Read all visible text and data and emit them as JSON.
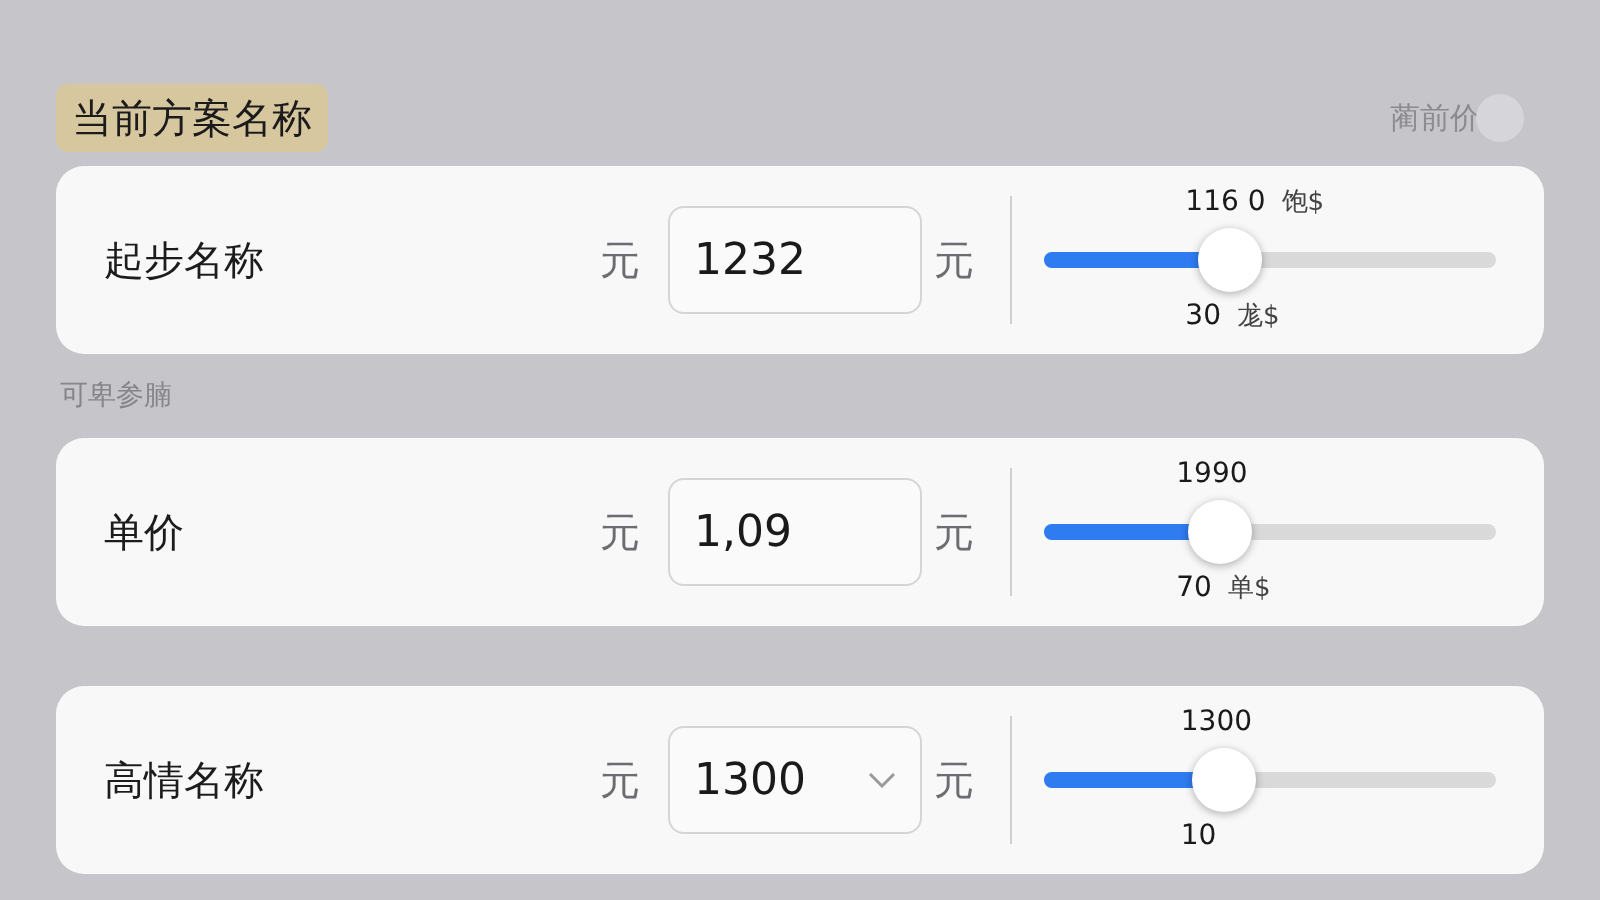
{
  "header": {
    "title": "当前方案名称",
    "right_label": "蔺前价"
  },
  "rows": [
    {
      "label": "起步名称",
      "prefix": "元",
      "kind": "input",
      "value": "1232",
      "suffix": "元",
      "slider": {
        "level": 0.41,
        "top_value": "116 0",
        "top_unit": "饱$",
        "bottom_value": "30",
        "bottom_unit": "尨$"
      }
    },
    {
      "section": "可卑参腩",
      "label": "单价",
      "prefix": "元",
      "kind": "input",
      "value": "1,09",
      "suffix": "元",
      "slider": {
        "level": 0.39,
        "top_value": "1990",
        "bottom_value": "70",
        "bottom_unit": "单$"
      }
    },
    {
      "label": "高情名称",
      "prefix": "元",
      "kind": "dropdown",
      "value": "1300",
      "suffix": "元",
      "slider": {
        "level": 0.4,
        "top_value": "1300",
        "bottom_value": "10"
      }
    }
  ]
}
